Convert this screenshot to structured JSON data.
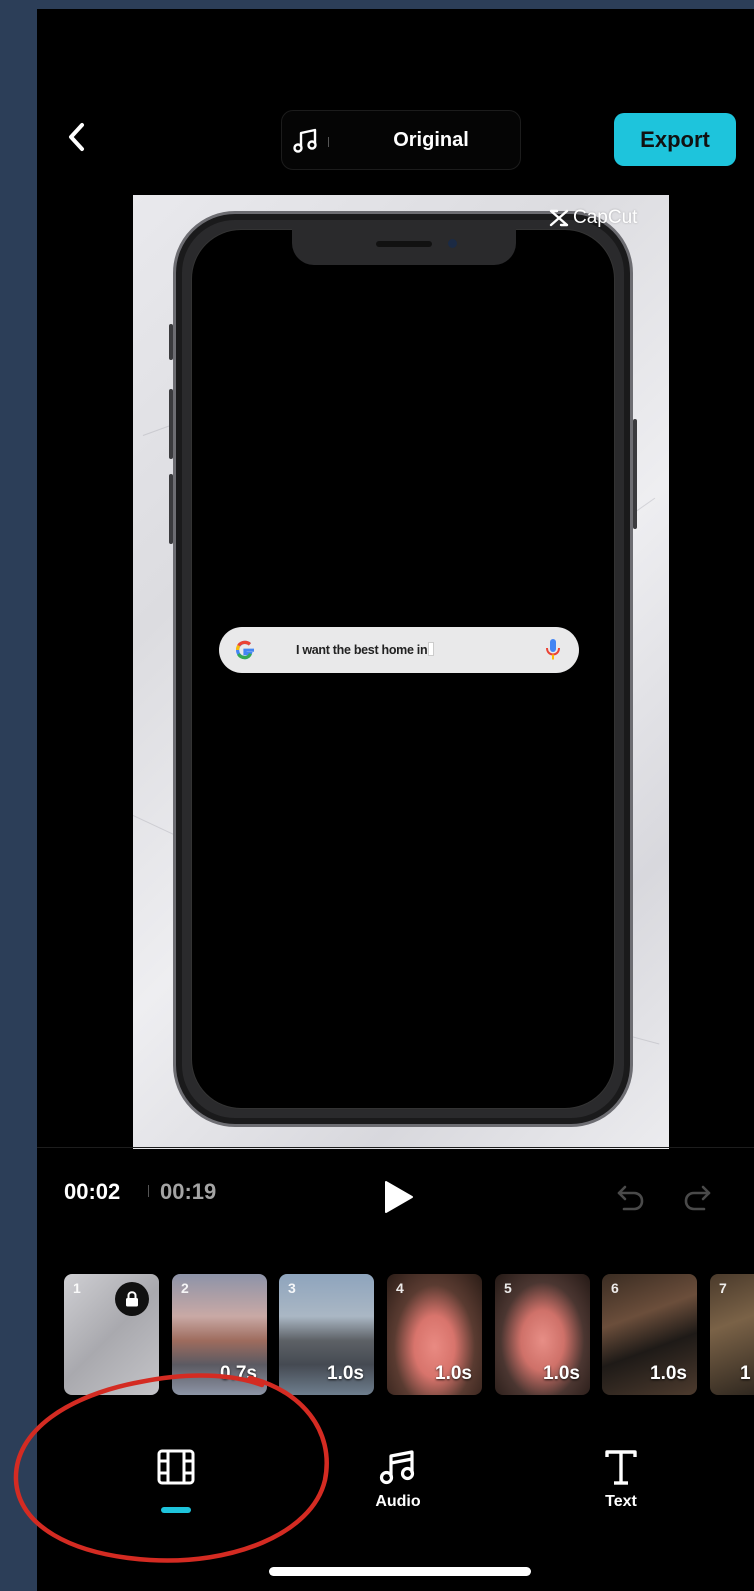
{
  "header": {
    "sound_label": "Original",
    "export_label": "Export"
  },
  "preview": {
    "watermark": "CapCut",
    "search_query": "I want the best home in"
  },
  "playback": {
    "current_time": "00:02",
    "total_time": "00:19"
  },
  "timeline": {
    "clips": [
      {
        "num": "1",
        "duration": "",
        "locked": true
      },
      {
        "num": "2",
        "duration": "0.7s"
      },
      {
        "num": "3",
        "duration": "1.0s"
      },
      {
        "num": "4",
        "duration": "1.0s"
      },
      {
        "num": "5",
        "duration": "1.0s"
      },
      {
        "num": "6",
        "duration": "1.0s"
      },
      {
        "num": "7",
        "duration": "1"
      }
    ]
  },
  "nav": {
    "edit_label": "",
    "audio_label": "Audio",
    "text_label": "Text"
  },
  "colors": {
    "accent": "#1ec4dc",
    "background": "#000000",
    "outer_background": "#2c3e58",
    "annotation": "#d42b22"
  },
  "icons": [
    "chevron-left-icon",
    "music-note-icon",
    "play-icon",
    "undo-icon",
    "redo-icon",
    "lock-icon",
    "film-strip-icon",
    "google-g-icon",
    "microphone-icon",
    "capcut-logo-icon"
  ]
}
